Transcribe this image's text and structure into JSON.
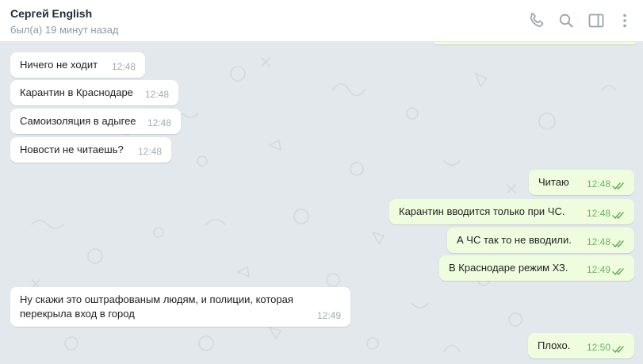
{
  "header": {
    "name": "Сергей English",
    "status": "был(а) 19 минут назад"
  },
  "icons": {
    "call": "phone-icon",
    "search": "search-icon",
    "panel": "sidebar-toggle-icon",
    "more": "more-vertical-icon"
  },
  "colors": {
    "incoming": "#ffffff",
    "outgoing": "#effdde",
    "read_check": "#5fb05c",
    "background": "#e3e8ec"
  },
  "messages": [
    {
      "dir": "in",
      "text": "Ничего не ходит",
      "time": "12:48"
    },
    {
      "dir": "in",
      "text": "Карантин в Краснодаре",
      "time": "12:48"
    },
    {
      "dir": "in",
      "text": "Самоизоляция в адыгее",
      "time": "12:48"
    },
    {
      "dir": "in",
      "text": "Новости не читаешь?",
      "time": "12:48"
    },
    {
      "dir": "out",
      "text": "Читаю",
      "time": "12:48"
    },
    {
      "dir": "out",
      "text": "Карантин вводится только при ЧС.",
      "time": "12:48"
    },
    {
      "dir": "out",
      "text": "А ЧС так то не вводили.",
      "time": "12:48"
    },
    {
      "dir": "out",
      "text": "В Краснодаре режим ХЗ.",
      "time": "12:49"
    },
    {
      "dir": "in",
      "text": "Ну скажи это оштрафованым людям, и полиции, которая перекрыла вход в город",
      "time": "12:49"
    },
    {
      "dir": "out",
      "text": "Плохо.",
      "time": "12:50"
    }
  ]
}
